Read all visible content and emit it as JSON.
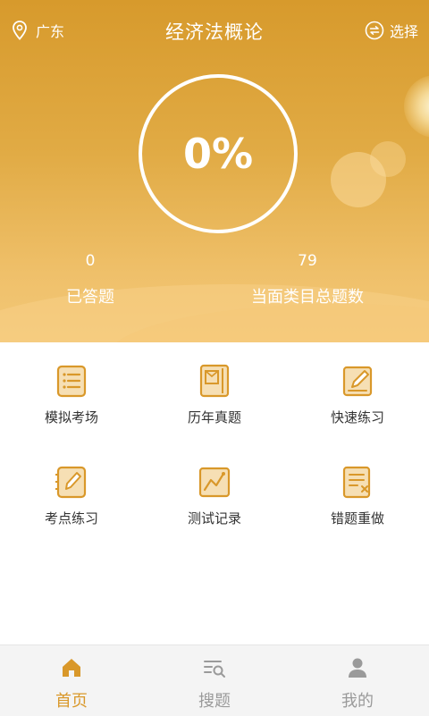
{
  "header": {
    "location": "广东",
    "title": "经济法概论",
    "select_label": "选择"
  },
  "progress": {
    "percent_text": "0%",
    "answered_count": "0",
    "answered_label": "已答题",
    "total_count": "79",
    "total_label": "当面类目总题数"
  },
  "menu": [
    {
      "label": "模拟考场",
      "icon": "list-doc-icon"
    },
    {
      "label": "历年真题",
      "icon": "book-icon"
    },
    {
      "label": "快速练习",
      "icon": "edit-doc-icon"
    },
    {
      "label": "考点练习",
      "icon": "pen-notebook-icon"
    },
    {
      "label": "测试记录",
      "icon": "chart-line-icon"
    },
    {
      "label": "错题重做",
      "icon": "wrong-doc-icon"
    }
  ],
  "tabs": [
    {
      "label": "首页",
      "icon": "home-icon",
      "active": true
    },
    {
      "label": "搜题",
      "icon": "search-list-icon",
      "active": false
    },
    {
      "label": "我的",
      "icon": "user-icon",
      "active": false
    }
  ],
  "colors": {
    "accent": "#d9982a",
    "icon_fill": "#f6dfb4",
    "tab_inactive": "#9a9a9a",
    "menu_text": "#333333"
  }
}
